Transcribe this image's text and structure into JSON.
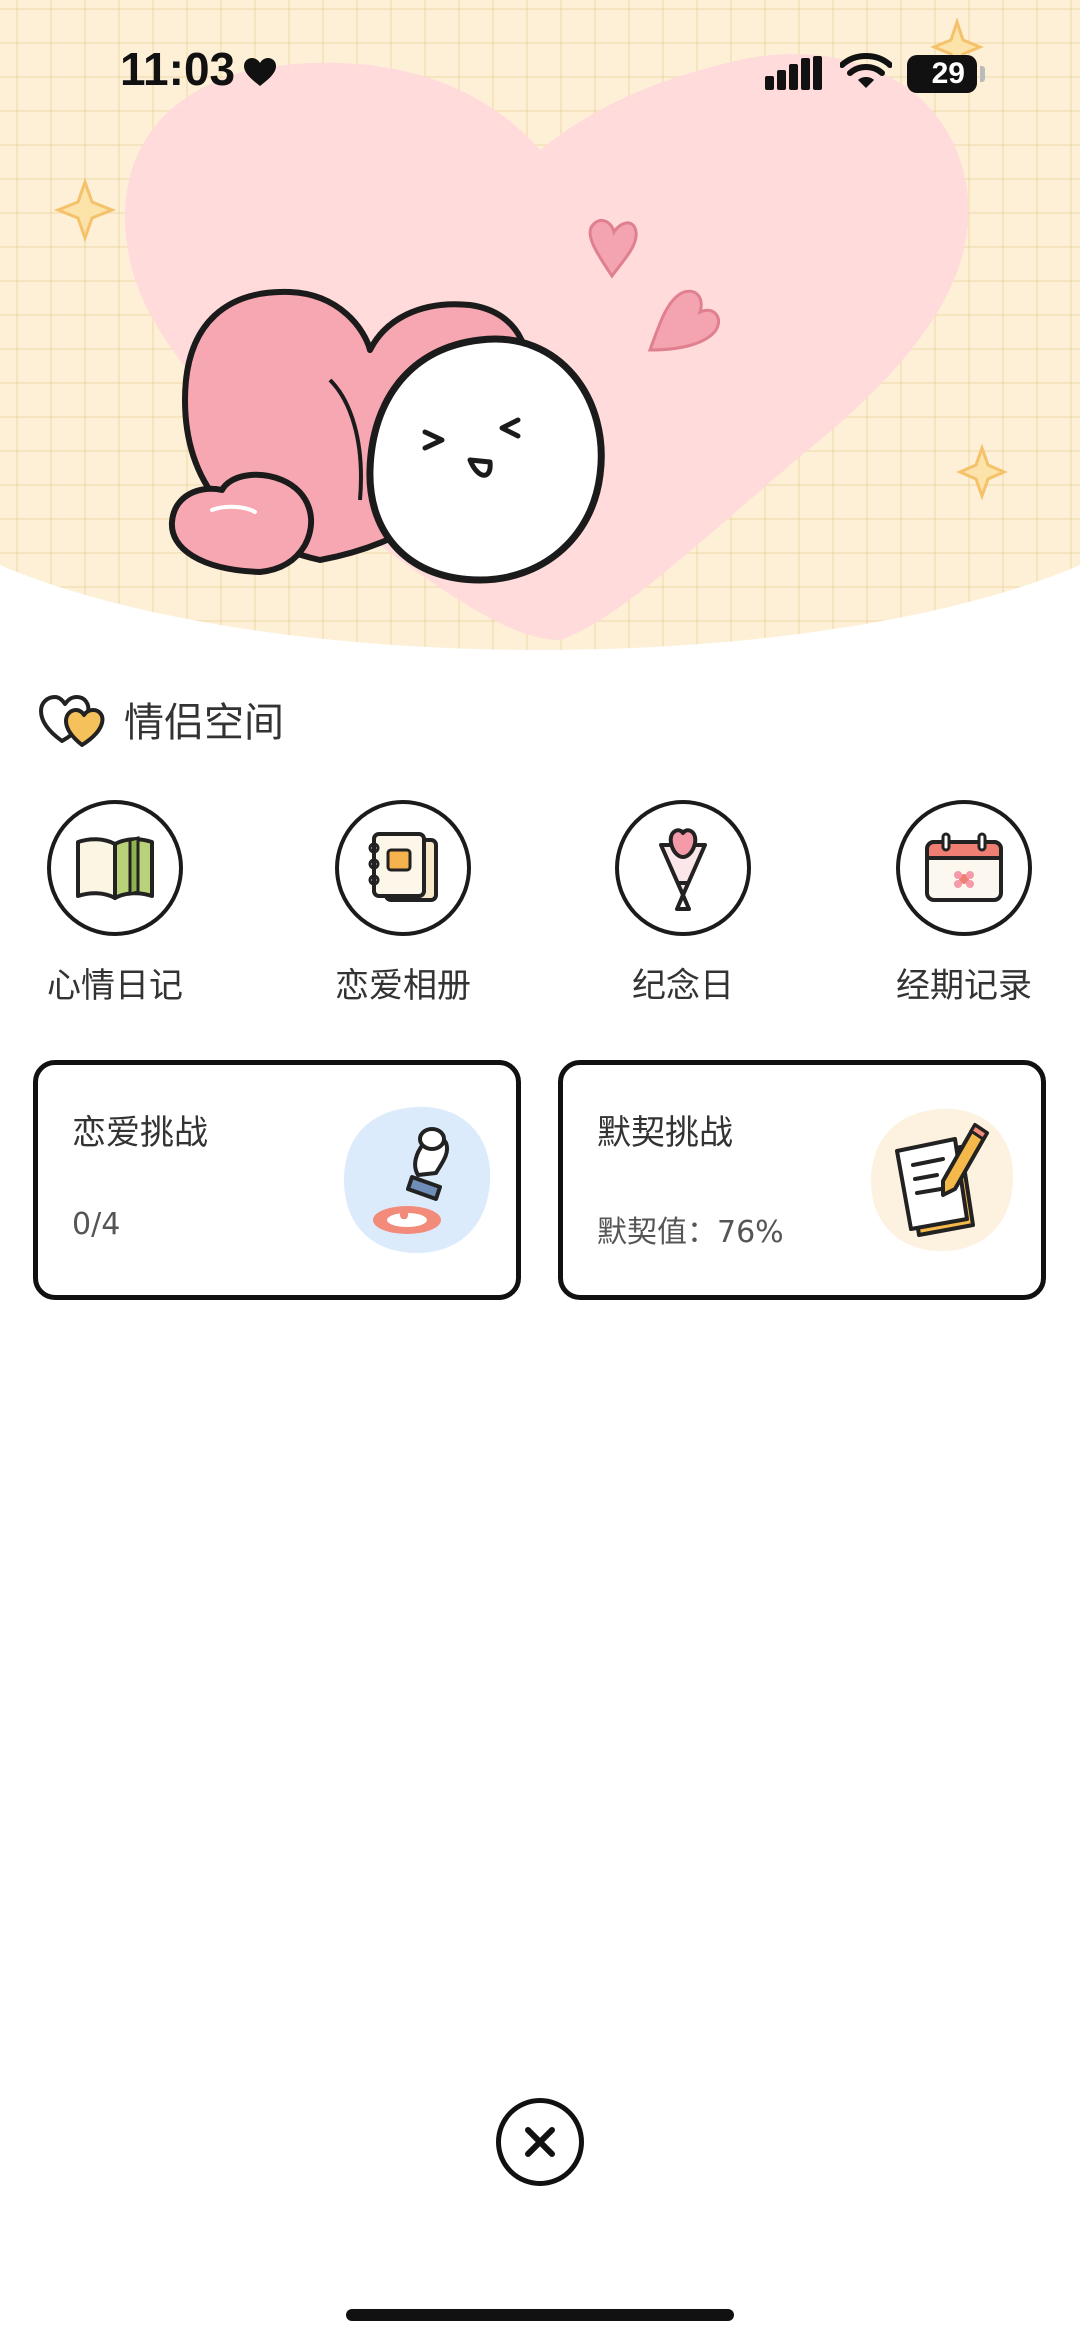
{
  "status_bar": {
    "time": "11:03",
    "battery": "29"
  },
  "section": {
    "title": "情侣空间"
  },
  "features": [
    {
      "label": "心情日记",
      "icon": "open-book-icon"
    },
    {
      "label": "恋爱相册",
      "icon": "photo-album-icon"
    },
    {
      "label": "纪念日",
      "icon": "flower-bouquet-icon"
    },
    {
      "label": "经期记录",
      "icon": "calendar-flower-icon"
    }
  ],
  "cards": [
    {
      "title": "恋爱挑战",
      "subtitle": "0/4",
      "icon": "stamp-icon"
    },
    {
      "title": "默契挑战",
      "subtitle": "默契值：76%",
      "icon": "pencil-paper-icon"
    }
  ],
  "colors": {
    "hero_bg": "#fdf0d6",
    "heart_pink": "#f7a7b2",
    "blob_pink": "#ffd9dc",
    "sparkle": "#f5c26b"
  }
}
